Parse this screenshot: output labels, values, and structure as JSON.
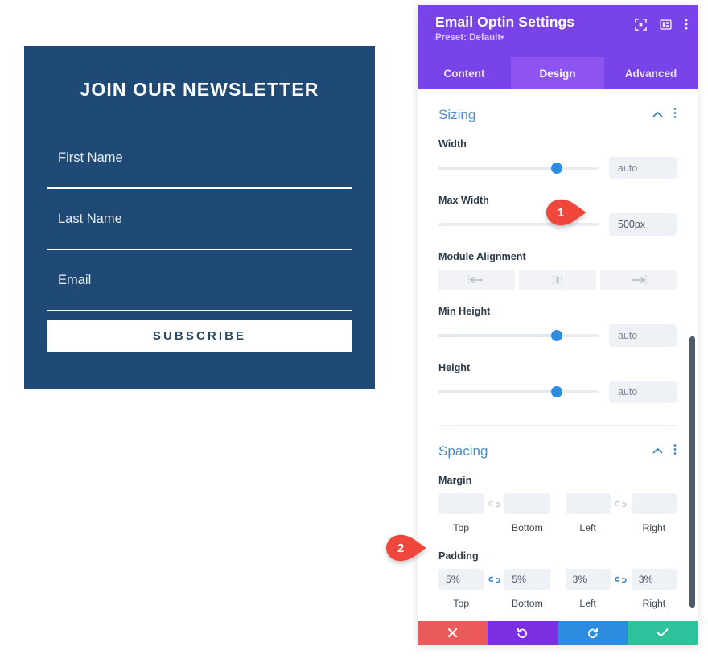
{
  "preview": {
    "title": "JOIN OUR NEWSLETTER",
    "fields": [
      {
        "name": "first-name",
        "label": "First Name"
      },
      {
        "name": "last-name",
        "label": "Last Name"
      },
      {
        "name": "email",
        "label": "Email"
      }
    ],
    "submit_label": "SUBSCRIBE",
    "bg_color": "#1e4a75",
    "text_color": "#ffffff"
  },
  "modal": {
    "title": "Email Optin Settings",
    "preset": "Preset: Default",
    "preset_caret": "▾",
    "accent_color": "#7843e9",
    "header_icons": [
      {
        "name": "focus-icon",
        "label": "Focus"
      },
      {
        "name": "layout-icon",
        "label": "Layout"
      },
      {
        "name": "more-options-icon",
        "label": "More"
      }
    ],
    "tabs": [
      {
        "label": "Content",
        "active": false
      },
      {
        "label": "Design",
        "active": true
      },
      {
        "label": "Advanced",
        "active": false
      }
    ],
    "sections": [
      {
        "id": "sizing",
        "title": "Sizing",
        "collapse_icon": "chevron-up-icon",
        "menu_icon": "more-options-icon"
      },
      {
        "id": "spacing",
        "title": "Spacing",
        "collapse_icon": "chevron-up-icon",
        "menu_icon": "more-options-icon"
      }
    ],
    "sizing": {
      "width": {
        "label": "Width",
        "value": "",
        "placeholder": "auto",
        "slider_pct": 74
      },
      "max_width": {
        "label": "Max Width",
        "value": "500px",
        "placeholder": "",
        "slider_pct": 0
      },
      "module_alignment": {
        "label": "Module Alignment",
        "options": [
          {
            "name": "align-left-icon",
            "label": "Left"
          },
          {
            "name": "align-center-icon",
            "label": "Center"
          },
          {
            "name": "align-right-icon",
            "label": "Right"
          }
        ],
        "selected": ""
      },
      "min_height": {
        "label": "Min Height",
        "value": "",
        "placeholder": "auto",
        "slider_pct": 74
      },
      "height": {
        "label": "Height",
        "value": "",
        "placeholder": "auto",
        "slider_pct": 74
      }
    },
    "spacing": {
      "margin": {
        "label": "Margin",
        "linked_tb": false,
        "linked_lr": false,
        "values": {
          "top": "",
          "bottom": "",
          "left": "",
          "right": ""
        },
        "captions": {
          "top": "Top",
          "bottom": "Bottom",
          "left": "Left",
          "right": "Right"
        }
      },
      "padding": {
        "label": "Padding",
        "linked_tb": true,
        "linked_lr": true,
        "values": {
          "top": "5%",
          "bottom": "5%",
          "left": "3%",
          "right": "3%"
        },
        "captions": {
          "top": "Top",
          "bottom": "Bottom",
          "left": "Left",
          "right": "Right"
        }
      }
    },
    "actions": [
      {
        "name": "cancel-button",
        "icon": "close-icon",
        "color": "#eb5a5a"
      },
      {
        "name": "undo-button",
        "icon": "undo-icon",
        "color": "#7b2fe0"
      },
      {
        "name": "redo-button",
        "icon": "redo-icon",
        "color": "#2d8ce0"
      },
      {
        "name": "save-button",
        "icon": "check-icon",
        "color": "#2ec19b"
      }
    ]
  },
  "callouts": [
    {
      "number": "1",
      "color": "#f0473c"
    },
    {
      "number": "2",
      "color": "#f0473c"
    }
  ]
}
